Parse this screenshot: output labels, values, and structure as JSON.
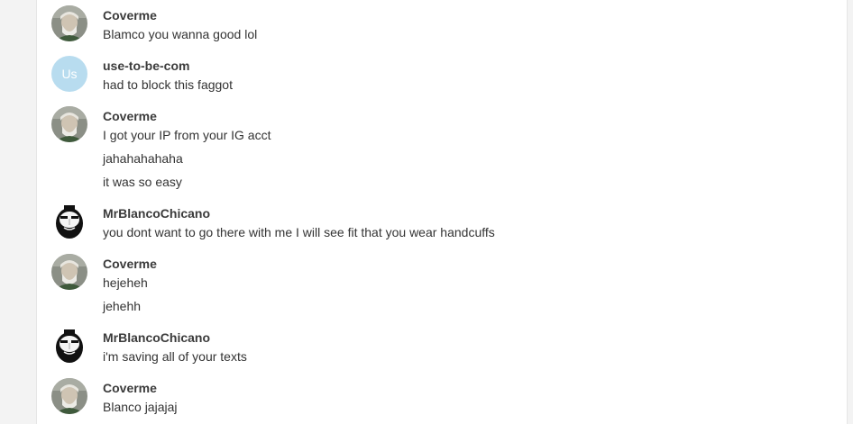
{
  "colors": {
    "background": "#f3f3f3",
    "panel": "#ffffff",
    "username": "#3b3b3b",
    "message": "#333333",
    "initials_avatar": "#b8dcef"
  },
  "groups": [
    {
      "user": "Coverme",
      "avatar": "photo-old-man",
      "messages": [
        "Blamco you wanna good lol"
      ]
    },
    {
      "user": "use-to-be-com",
      "avatar": "initials",
      "initials": "Us",
      "messages": [
        "had  to block this faggot"
      ]
    },
    {
      "user": "Coverme",
      "avatar": "photo-old-man",
      "messages": [
        "I got your IP from your IG acct",
        "jahahahahaha",
        "it was so easy"
      ]
    },
    {
      "user": "MrBlancoChicano",
      "avatar": "bw-face",
      "messages": [
        "you dont want to go there with me I will see fit that you wear handcuffs"
      ]
    },
    {
      "user": "Coverme",
      "avatar": "photo-old-man",
      "messages": [
        "hejeheh",
        "jehehh"
      ]
    },
    {
      "user": "MrBlancoChicano",
      "avatar": "bw-face",
      "messages": [
        "i'm saving all of your texts"
      ]
    },
    {
      "user": "Coverme",
      "avatar": "photo-old-man",
      "messages": [
        "Blanco jajajaj"
      ]
    }
  ]
}
